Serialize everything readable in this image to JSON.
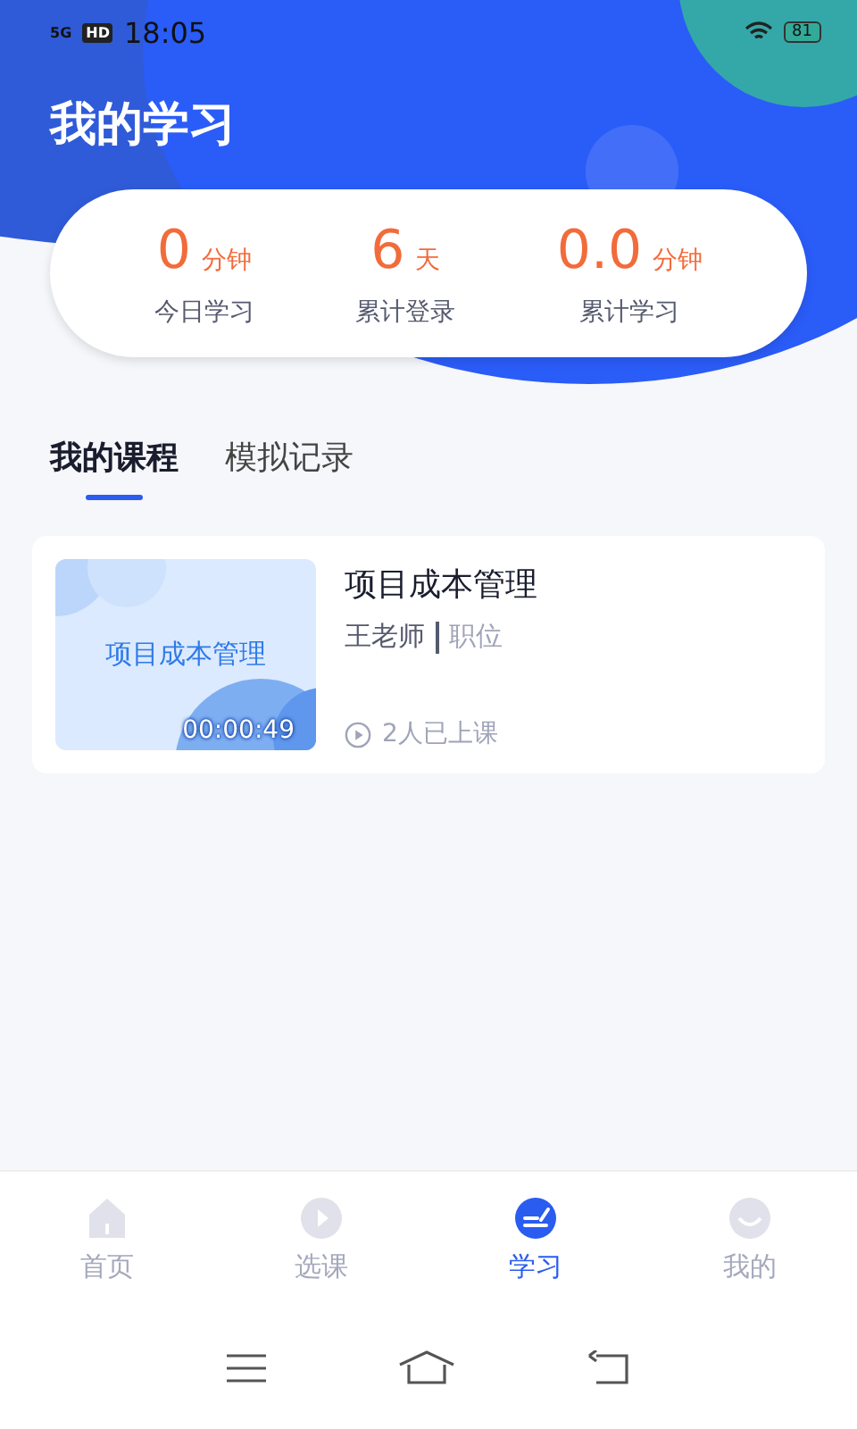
{
  "status_bar": {
    "network": "5G",
    "hd": "HD",
    "time": "18:05",
    "battery": "81"
  },
  "title": "我的学习",
  "stats": [
    {
      "value": "0",
      "unit": "分钟",
      "label": "今日学习"
    },
    {
      "value": "6",
      "unit": "天",
      "label": "累计登录"
    },
    {
      "value": "0.0",
      "unit": "分钟",
      "label": "累计学习"
    }
  ],
  "tabs": [
    {
      "label": "我的课程",
      "selected": true
    },
    {
      "label": "模拟记录",
      "selected": false
    }
  ],
  "courses": [
    {
      "cover_title": "项目成本管理",
      "duration": "00:00:49",
      "title": "项目成本管理",
      "teacher": "王老师",
      "position": "职位",
      "learners": "2人已上课"
    }
  ],
  "nav": [
    {
      "kind": "home",
      "label": "首页",
      "selected": false
    },
    {
      "kind": "play",
      "label": "选课",
      "selected": false
    },
    {
      "kind": "study",
      "label": "学习",
      "selected": true
    },
    {
      "kind": "me",
      "label": "我的",
      "selected": false
    }
  ]
}
